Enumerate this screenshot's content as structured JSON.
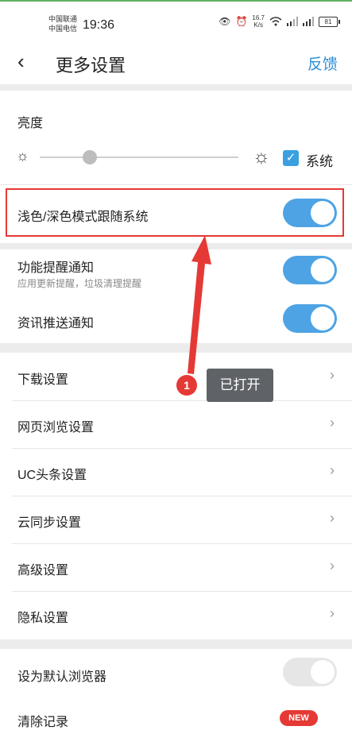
{
  "status_bar": {
    "carrier1": "中国联通",
    "carrier2": "中国电信",
    "time": "19:36",
    "speed_value": "16.7",
    "speed_unit": "K/s",
    "battery": "81"
  },
  "header": {
    "title": "更多设置",
    "feedback": "反馈"
  },
  "brightness": {
    "label": "亮度",
    "level": 0.25,
    "system_label": "系统",
    "system_checked": true
  },
  "toggles": [
    {
      "label": "浅色/深色模式跟随系统",
      "on": true
    },
    {
      "label": "功能提醒通知",
      "sub": "应用更新提醒，垃圾清理提醒",
      "on": true
    },
    {
      "label": "资讯推送通知",
      "on": true
    }
  ],
  "menu": [
    {
      "label": "下载设置"
    },
    {
      "label": "网页浏览设置"
    },
    {
      "label": "UC头条设置"
    },
    {
      "label": "云同步设置"
    },
    {
      "label": "高级设置"
    },
    {
      "label": "隐私设置"
    }
  ],
  "bottom": {
    "default_browser": "设为默认浏览器",
    "clear_records": "清除记录",
    "new_badge": "NEW"
  },
  "annotation": {
    "badge": "1",
    "tip": "已打开"
  },
  "colors": {
    "accent": "#4ea3e4",
    "highlight": "#e53935"
  }
}
